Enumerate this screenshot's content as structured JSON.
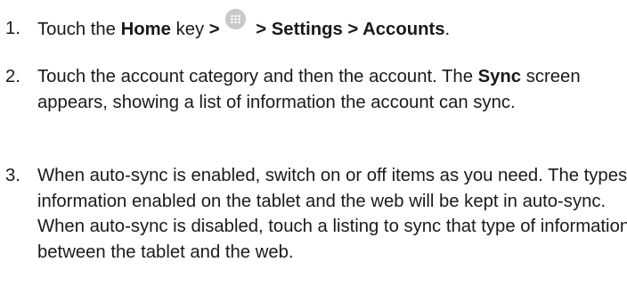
{
  "steps": [
    {
      "number": "1.",
      "parts": {
        "t1": "Touch the ",
        "b1": "Home",
        "t2": " key ",
        "b2": ">",
        "b3": " > Settings > Accounts",
        "t3": "."
      },
      "icon": "apps-grid-icon"
    },
    {
      "number": "2.",
      "parts": {
        "t1": "Touch the account category and then the account. The ",
        "b1": "Sync",
        "t2": " screen appears, showing a list of information the account can sync."
      }
    },
    {
      "number": "3.",
      "parts": {
        "t1": "When auto-sync is enabled, switch on or off items as you need. The types of information enabled on the tablet and the web will be kept in auto-sync. When auto-sync is disabled, touch a listing to sync that type of information between the tablet and the web."
      }
    }
  ]
}
